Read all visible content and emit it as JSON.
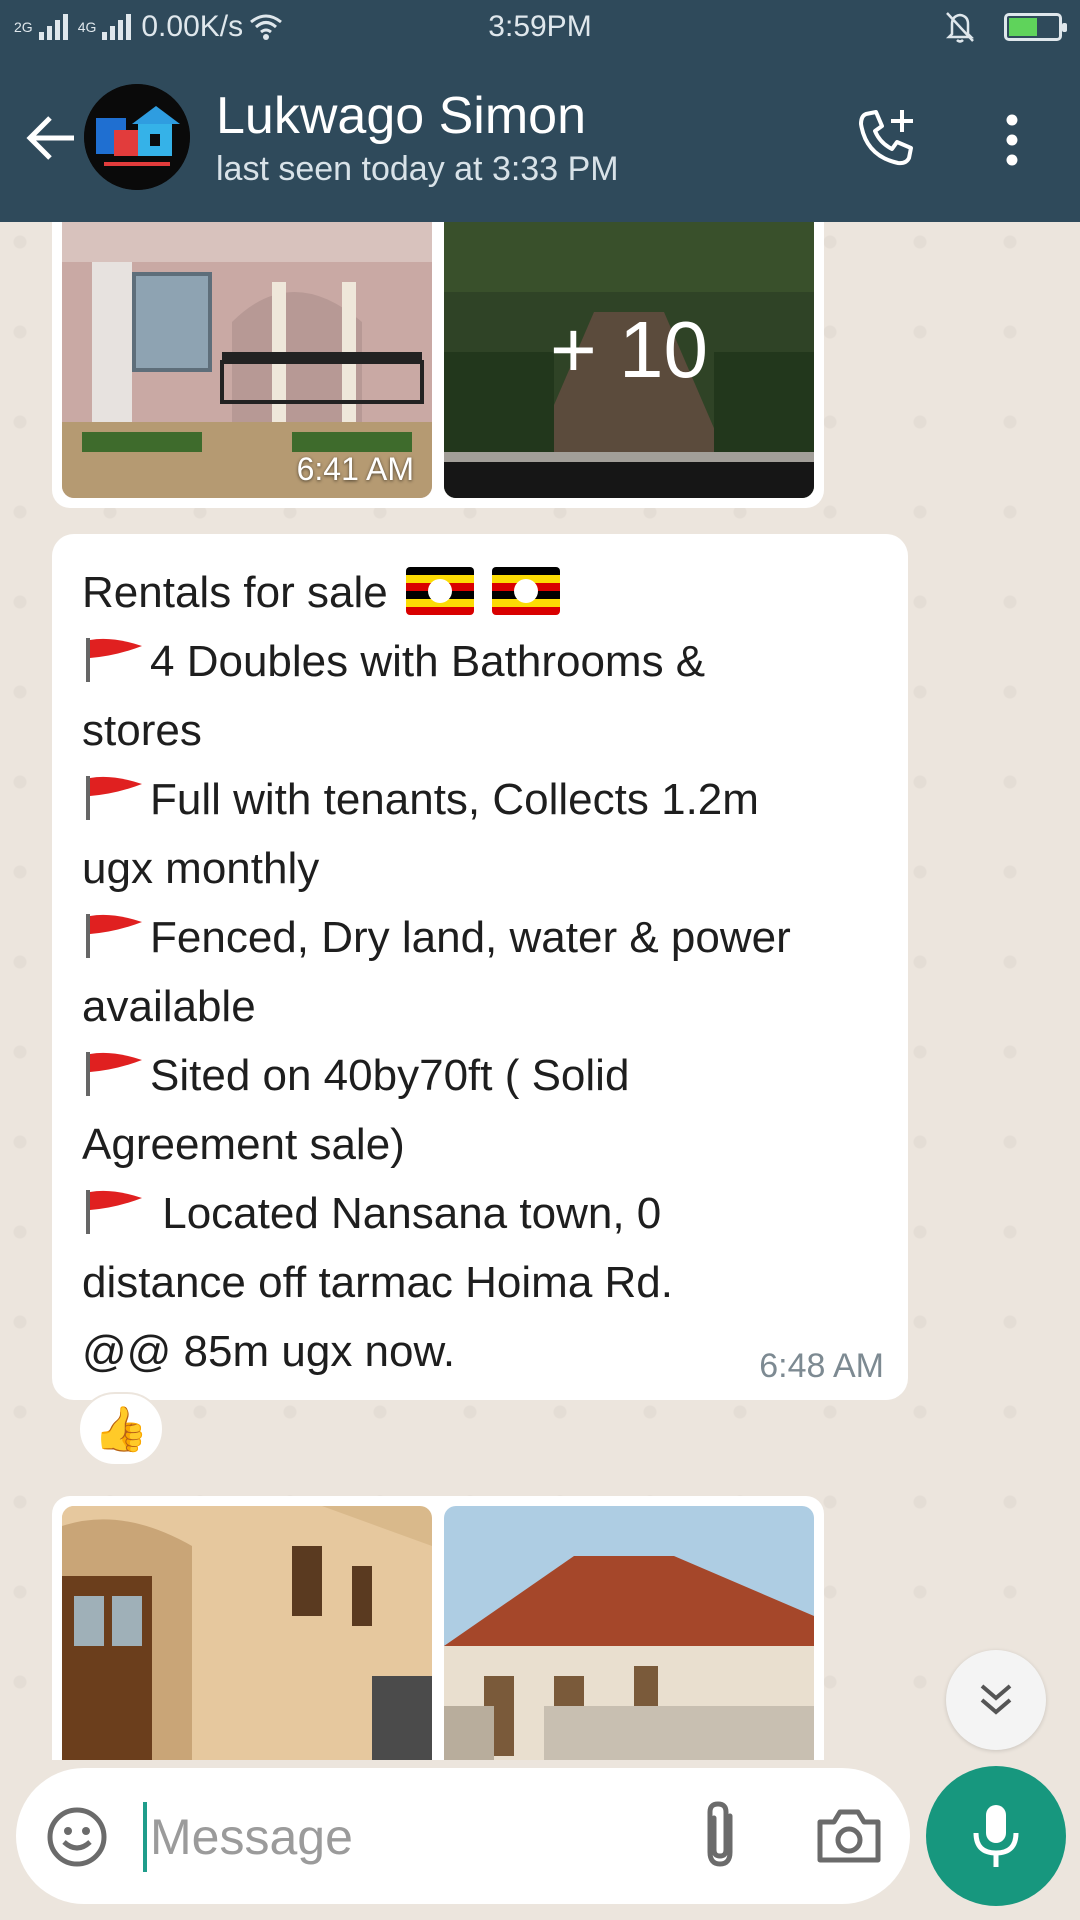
{
  "status_bar": {
    "network_left": "2G",
    "network_right": "4G",
    "speed": "0.00K/s",
    "time": "3:59PM",
    "icons": [
      "signal-icon",
      "wifi-icon",
      "bell-off-icon",
      "battery-charging-icon"
    ]
  },
  "header": {
    "contact_name": "Lukwago Simon",
    "last_seen": "last seen today at 3:33 PM",
    "icons": [
      "back-arrow-icon",
      "add-call-icon",
      "more-vert-icon"
    ]
  },
  "messages": {
    "media_top": {
      "time": "6:41 AM",
      "more_count": "+ 10"
    },
    "text_message": {
      "lines": [
        "Rentals for sale",
        "4 Doubles with Bathrooms &",
        "stores",
        "Full with tenants, Collects 1.2m",
        "ugx monthly",
        "Fenced, Dry land, water & power",
        "available",
        "Sited on 40by70ft ( Solid",
        "Agreement sale)",
        " Located Nansana town, 0",
        "distance off tarmac Hoima Rd.",
        "@@ 85m ugx now."
      ],
      "time": "6:48 AM",
      "reaction": "👍"
    }
  },
  "input": {
    "placeholder": "Message"
  },
  "colors": {
    "header_bg": "#2f4a5b",
    "chat_bg": "#ece5dd",
    "accent": "#17977e"
  }
}
